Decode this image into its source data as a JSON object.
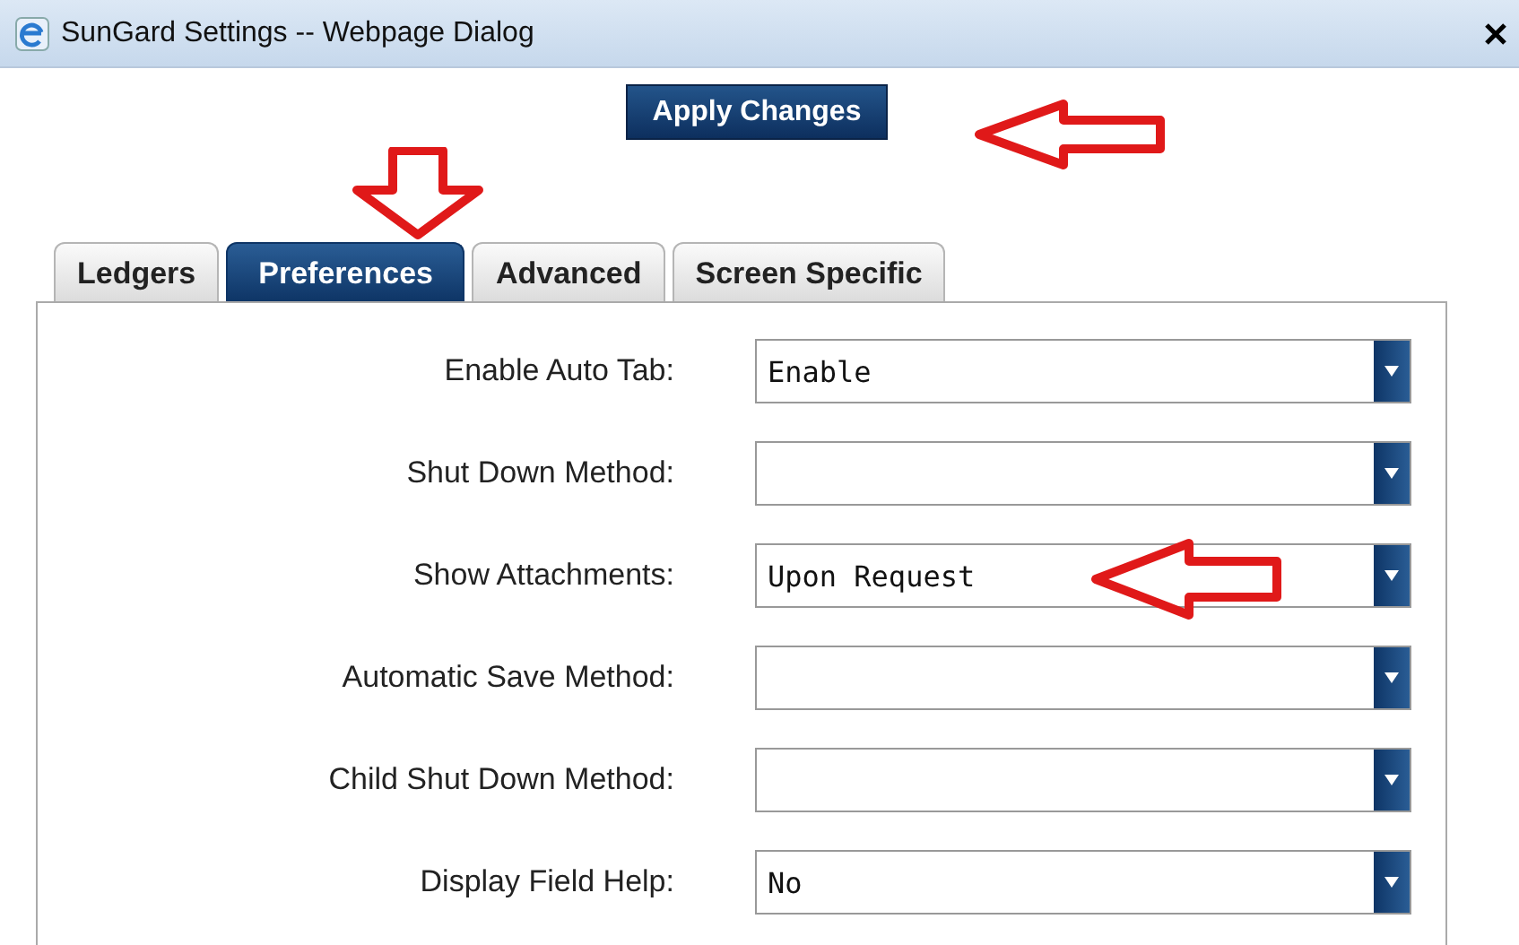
{
  "window": {
    "title": "SunGard Settings -- Webpage Dialog"
  },
  "apply_button": {
    "label": "Apply Changes"
  },
  "tabs": [
    {
      "label": "Ledgers",
      "selected": false
    },
    {
      "label": "Preferences",
      "selected": true
    },
    {
      "label": "Advanced",
      "selected": false
    },
    {
      "label": "Screen Specific",
      "selected": false
    }
  ],
  "settings": [
    {
      "label": "Enable Auto Tab:",
      "value": "Enable"
    },
    {
      "label": "Shut Down Method:"
    },
    {
      "label": "Show Attachments:",
      "value": "Upon Request"
    },
    {
      "label": "Automatic Save Method:"
    },
    {
      "label": "Child Shut Down Method:"
    },
    {
      "label": "Display Field Help:",
      "value": "No"
    }
  ]
}
